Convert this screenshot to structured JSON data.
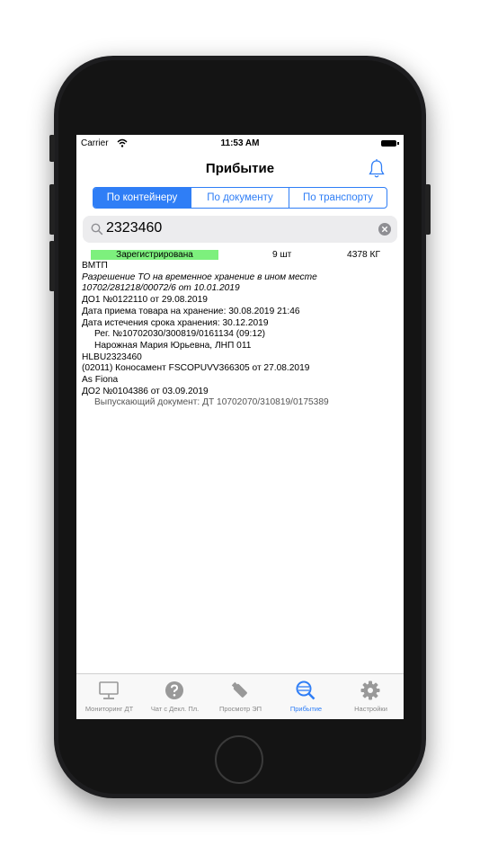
{
  "status_bar": {
    "carrier": "Carrier",
    "time": "11:53 AM"
  },
  "nav": {
    "title": "Прибытие",
    "bell_icon": "bell-icon"
  },
  "segments": [
    {
      "label": "По контейнеру",
      "active": true
    },
    {
      "label": "По документу",
      "active": false
    },
    {
      "label": "По транспорту",
      "active": false
    }
  ],
  "search": {
    "value": "2323460"
  },
  "record": {
    "status": "Зарегистрирована",
    "status_color": "#7df07d",
    "quantity": "9 шт",
    "weight": "4378 КГ",
    "lines": [
      "ВМТП",
      "Разрешение ТО на временное хранение в ином месте",
      "10702/281218/00072/6 от 10.01.2019",
      "ДО1 №0122110 от 29.08.2019",
      "Дата приема товара на хранение: 30.08.2019 21:46",
      "Дата истечения срока хранения: 30.12.2019",
      "Рег. №10702030/300819/0161134 (09:12)",
      "Нарожная Мария Юрьевна, ЛНП 011",
      "HLBU2323460",
      "(02011) Коносамент FSCOPUVV366305 от 27.08.2019",
      "As Fiona",
      "ДО2 №0104386 от 03.09.2019",
      "Выпускающий документ: ДТ 10702070/310819/0175389"
    ]
  },
  "tabs": [
    {
      "label": "Мониторинг ДТ",
      "icon": "monitor-icon"
    },
    {
      "label": "Чат с Декл. Пл.",
      "icon": "help-circle-icon"
    },
    {
      "label": "Просмотр ЭП",
      "icon": "usb-key-icon"
    },
    {
      "label": "Прибытие",
      "icon": "search-globe-icon",
      "active": true
    },
    {
      "label": "Настройки",
      "icon": "gear-icon"
    }
  ],
  "colors": {
    "accent": "#2f7ef6",
    "inactive_tab": "#888888"
  }
}
